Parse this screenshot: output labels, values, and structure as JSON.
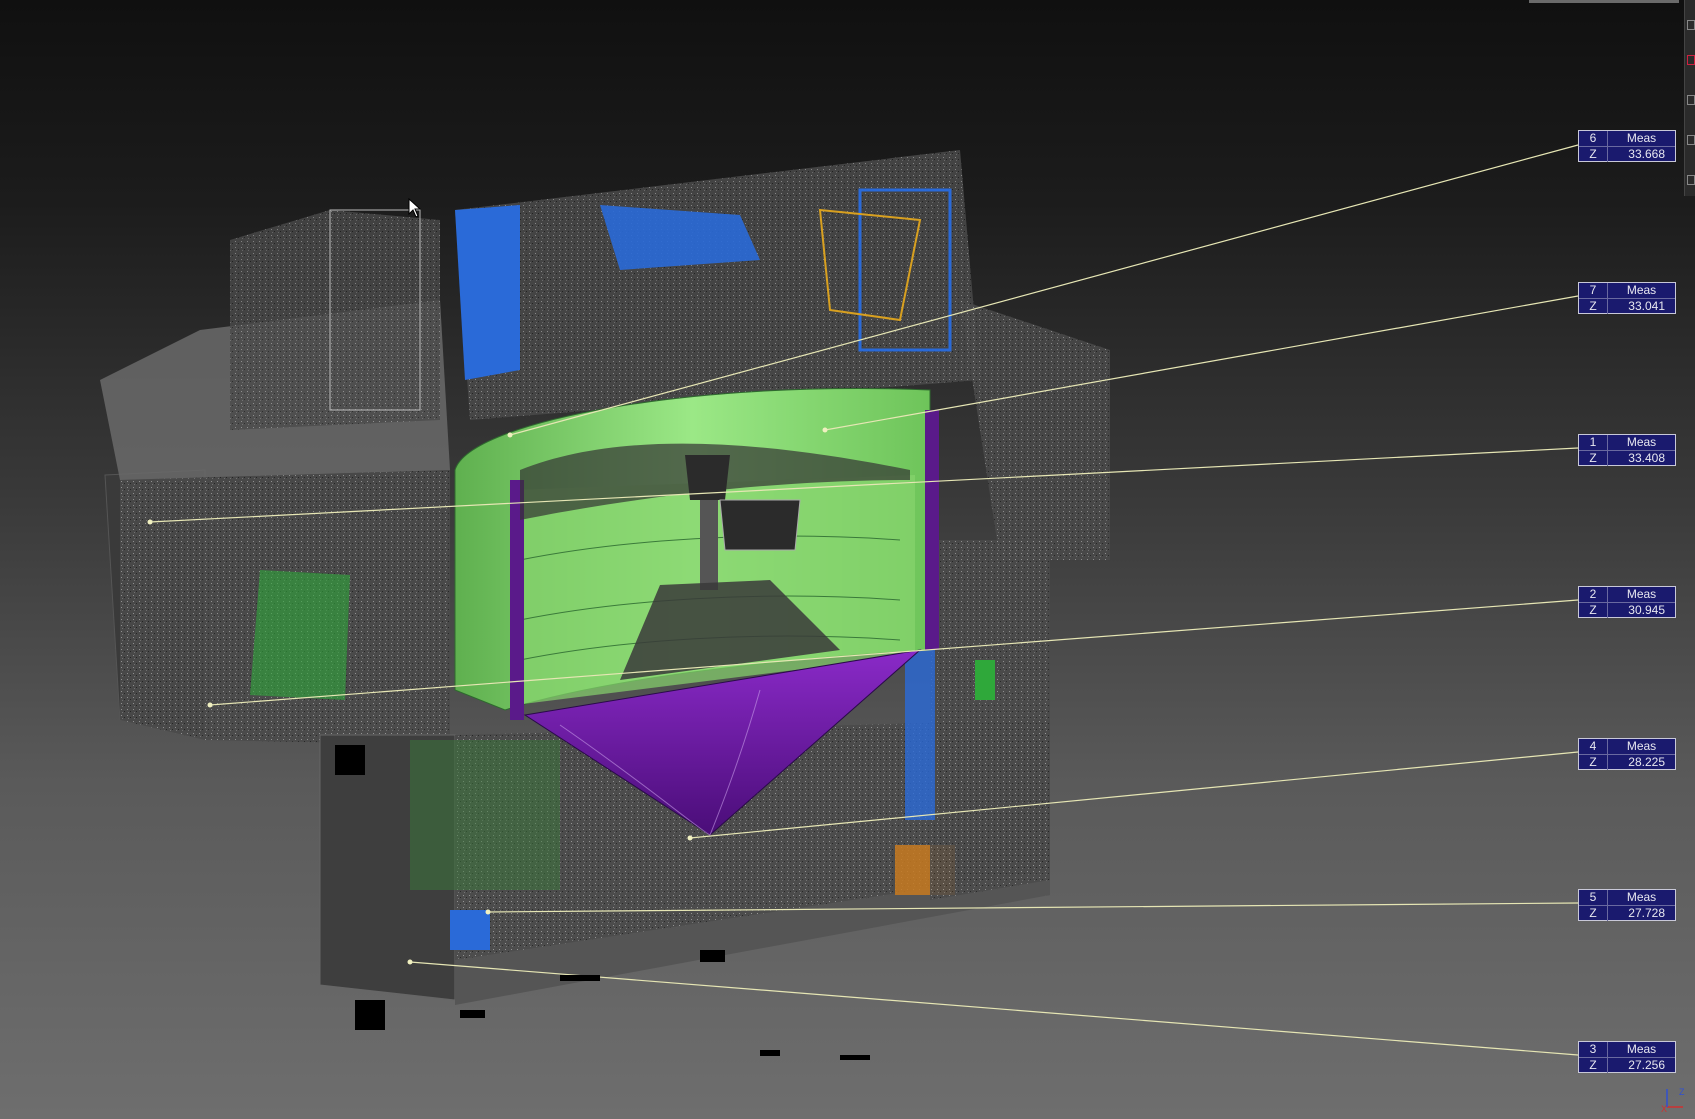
{
  "viewport": {
    "name": "3D point cloud viewport"
  },
  "measurements": [
    {
      "id": "6",
      "type": "Meas",
      "axis": "Z",
      "value": "33.668"
    },
    {
      "id": "7",
      "type": "Meas",
      "axis": "Z",
      "value": "33.041"
    },
    {
      "id": "1",
      "type": "Meas",
      "axis": "Z",
      "value": "33.408"
    },
    {
      "id": "2",
      "type": "Meas",
      "axis": "Z",
      "value": "30.945"
    },
    {
      "id": "4",
      "type": "Meas",
      "axis": "Z",
      "value": "28.225"
    },
    {
      "id": "5",
      "type": "Meas",
      "axis": "Z",
      "value": "27.728"
    },
    {
      "id": "3",
      "type": "Meas",
      "axis": "Z",
      "value": "27.256"
    }
  ],
  "axis_triad": {
    "x_label": "X",
    "z_label": "Z"
  },
  "colors": {
    "tank_green": "#8ee07a",
    "cone_purple": "#6a1aa0",
    "steel_blue": "#2a6ad8",
    "label_bg": "#1a1a6e",
    "leader_line": "#e6e6b4"
  }
}
